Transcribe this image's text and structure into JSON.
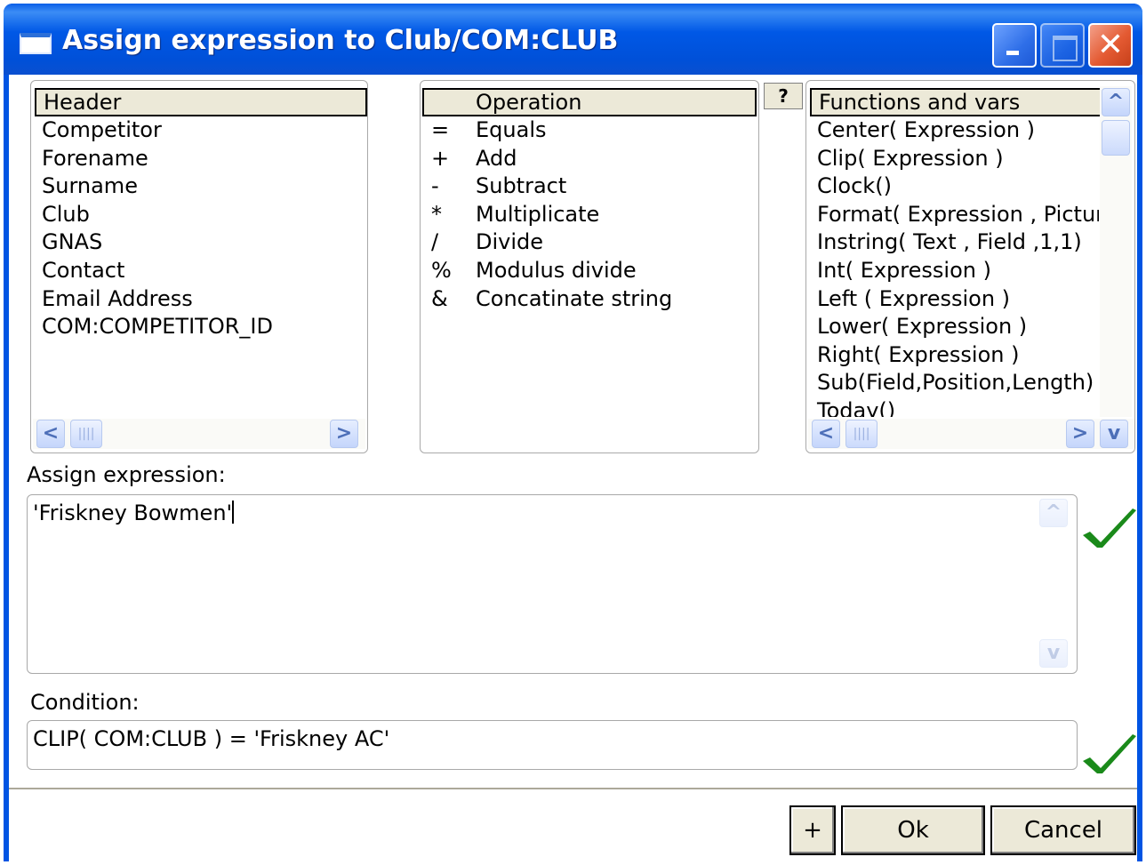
{
  "window": {
    "title": "Assign expression to Club/COM:CLUB",
    "controls": {
      "minimize_icon": "minimize-icon",
      "maximize_icon": "maximize-icon",
      "close_icon": "close-icon",
      "close_glyph": "✕"
    }
  },
  "header_list": {
    "header": "Header",
    "items": [
      "Competitor",
      "Forename",
      "Surname",
      "Club",
      "GNAS",
      "Contact",
      "Email Address",
      "COM:COMPETITOR_ID"
    ],
    "scroll_left": "<",
    "scroll_right": ">",
    "thumb": "||||"
  },
  "operation_list": {
    "header": "Operation",
    "items": [
      {
        "symbol": "=",
        "label": "Equals"
      },
      {
        "symbol": "+",
        "label": "Add"
      },
      {
        "symbol": "-",
        "label": "Subtract"
      },
      {
        "symbol": "*",
        "label": "Multiplicate"
      },
      {
        "symbol": "/",
        "label": "Divide"
      },
      {
        "symbol": "%",
        "label": "Modulus divide"
      },
      {
        "symbol": "&",
        "label": "Concatinate string"
      }
    ]
  },
  "help_button": "?",
  "functions_list": {
    "header": "Functions and vars",
    "items": [
      "Center( Expression )",
      "Clip( Expression )",
      "Clock()",
      "Format( Expression , Picture",
      "Instring( Text , Field ,1,1)",
      "Int( Expression )",
      "Left ( Expression )",
      "Lower( Expression )",
      "Right( Expression )",
      "Sub(Field,Position,Length)",
      "Today()"
    ],
    "scroll_up": "^",
    "scroll_down": "v",
    "scroll_left": "<",
    "scroll_right": ">",
    "thumb": "||||"
  },
  "assign_expression": {
    "label": "Assign expression:",
    "value": "'Friskney Bowmen'"
  },
  "condition": {
    "label": "Condition:",
    "value": "CLIP( COM:CLUB ) =  'Friskney AC'"
  },
  "buttons": {
    "plus": "+",
    "ok": "Ok",
    "cancel": "Cancel"
  },
  "colors": {
    "titlebar": "#0054e3",
    "check": "#1a8a1a"
  }
}
